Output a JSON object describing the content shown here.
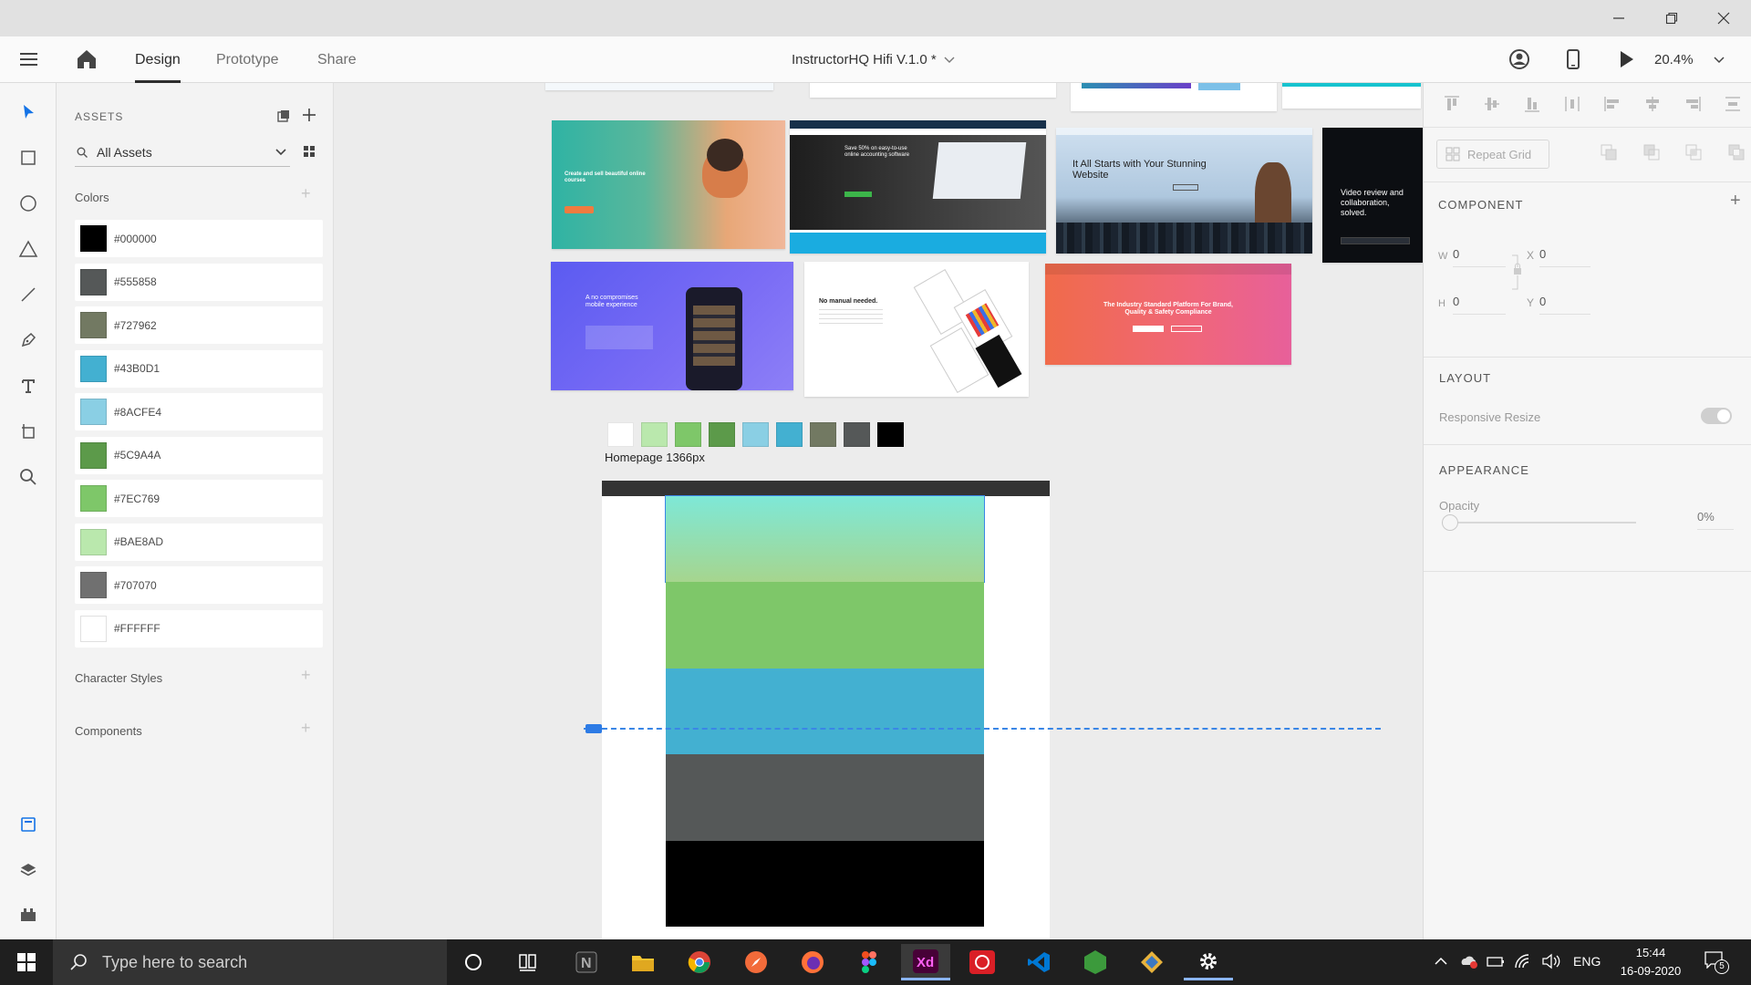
{
  "header": {
    "tabs": [
      {
        "label": "Design",
        "active": true
      },
      {
        "label": "Prototype",
        "active": false
      },
      {
        "label": "Share",
        "active": false
      }
    ],
    "doc_title": "InstructorHQ Hifi V.1.0 *",
    "zoom": "20.4%"
  },
  "assets": {
    "title": "ASSETS",
    "filter": "All Assets",
    "colors_heading": "Colors",
    "colors": [
      "#000000",
      "#555858",
      "#727962",
      "#43B0D1",
      "#8ACFE4",
      "#5C9A4A",
      "#7EC769",
      "#BAE8AD",
      "#707070",
      "#FFFFFF"
    ],
    "char_styles_heading": "Character Styles",
    "components_heading": "Components"
  },
  "canvas": {
    "palette": [
      "#FFFFFF",
      "#BAE8AD",
      "#7EC769",
      "#5C9A4A",
      "#8ACFE4",
      "#43B0D1",
      "#727962",
      "#555858",
      "#000000"
    ],
    "artboard_name": "Homepage 1366px",
    "artboard_bands": [
      "gradient",
      "#7EC769",
      "#43B0D1",
      "#555858",
      "#000000"
    ],
    "thumbs": {
      "wix_headline": "It All Starts with Your Stunning Website",
      "dark_text": "Video review and collaboration, solved.",
      "nomanual": "No manual needed.",
      "purple_text": "A no compromises mobile experience",
      "green_headline": "Create and sell beautiful online courses",
      "acct_headline": "Save 50% on easy-to-use online accounting software",
      "orange_headline": "The Industry Standard Platform For Brand, Quality & Safety Compliance"
    }
  },
  "props": {
    "repeat_grid": "Repeat Grid",
    "component_title": "COMPONENT",
    "w_label": "W",
    "w_value": "0",
    "x_label": "X",
    "x_value": "0",
    "h_label": "H",
    "h_value": "0",
    "y_label": "Y",
    "y_value": "0",
    "layout_title": "LAYOUT",
    "responsive_resize": "Responsive Resize",
    "appearance_title": "APPEARANCE",
    "opacity_label": "Opacity",
    "opacity_value": "0%"
  },
  "taskbar": {
    "search_placeholder": "Type here to search",
    "lang": "ENG",
    "time": "15:44",
    "date": "16-09-2020",
    "notifications": "5"
  }
}
